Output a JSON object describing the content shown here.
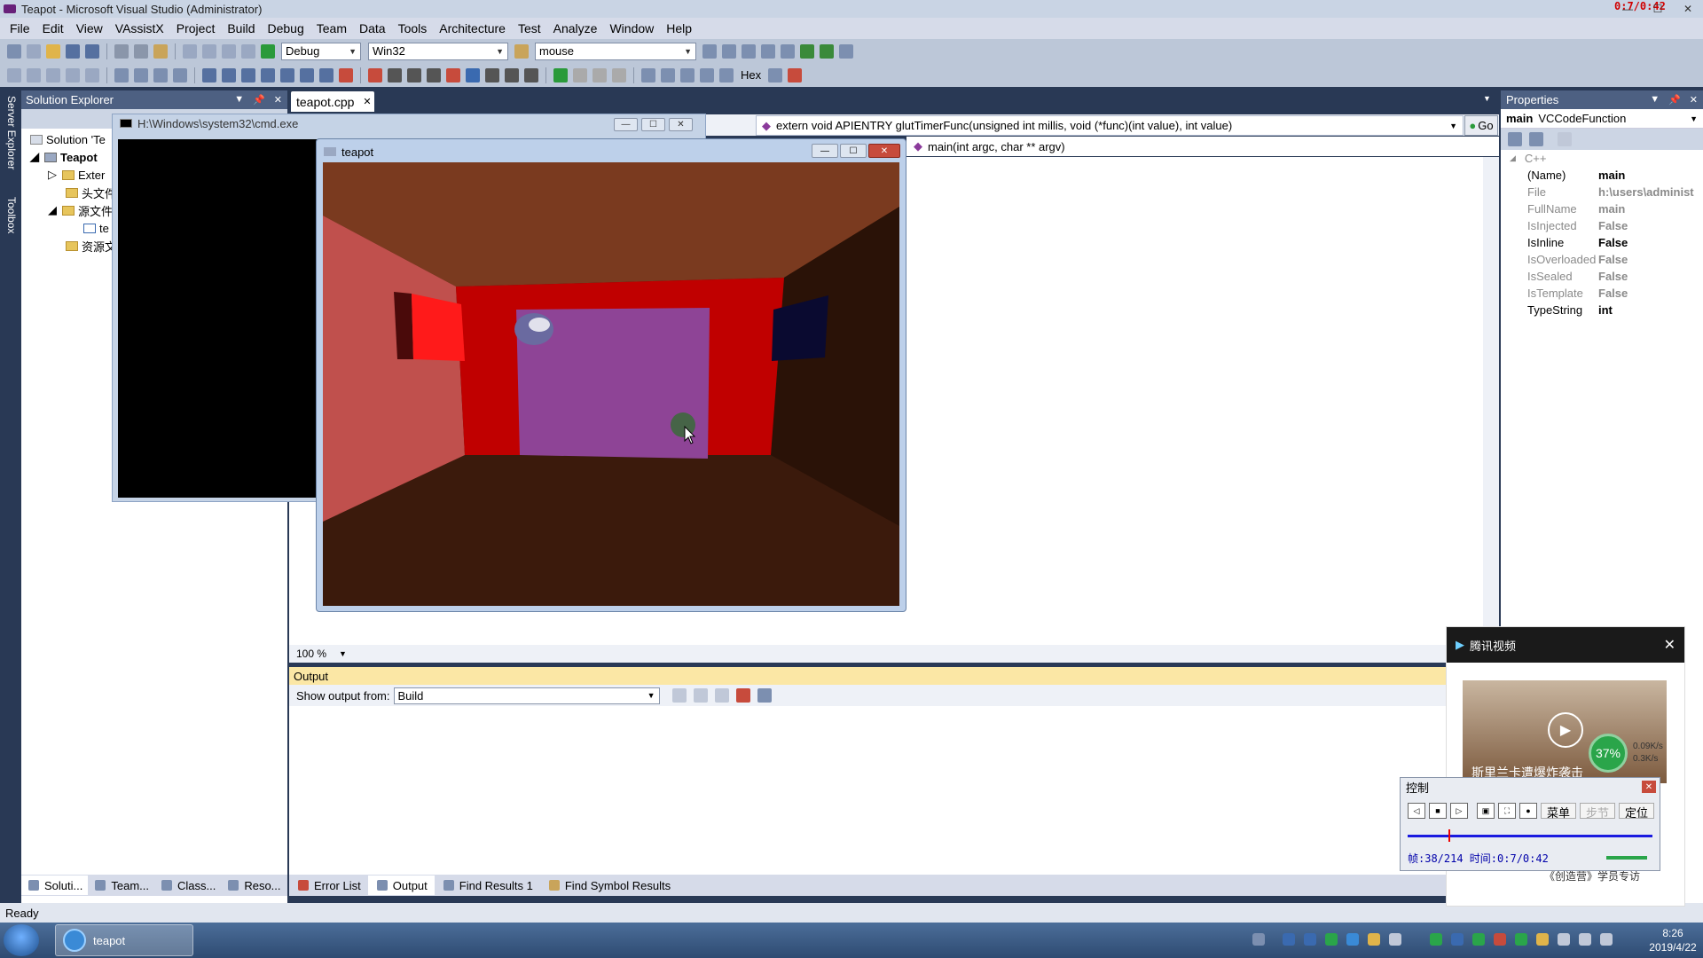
{
  "window": {
    "title": "Teapot - Microsoft Visual Studio (Administrator)",
    "recorder_time": "0:7/0:42"
  },
  "menu": [
    "File",
    "Edit",
    "View",
    "VAssistX",
    "Project",
    "Build",
    "Debug",
    "Team",
    "Data",
    "Tools",
    "Architecture",
    "Test",
    "Analyze",
    "Window",
    "Help"
  ],
  "toolbar": {
    "config": "Debug",
    "platform": "Win32",
    "find": "mouse",
    "hex_label": "Hex"
  },
  "left_strip": {
    "server_explorer": "Server Explorer",
    "toolbox": "Toolbox"
  },
  "solution_explorer": {
    "title": "Solution Explorer",
    "items": [
      "Solution 'Te",
      "Teapot",
      "Exter",
      "头文件",
      "源文件",
      "te",
      "资源文"
    ]
  },
  "left_tabs": [
    "Soluti...",
    "Team...",
    "Class...",
    "Reso..."
  ],
  "editor": {
    "tab": "teapot.cpp",
    "nav_func": "extern void APIENTRY glutTimerFunc(unsigned int millis, void (*func)(int value), int value)",
    "go_label": "Go",
    "nav_member": "main(int argc, char ** argv)",
    "zoom": "100 %"
  },
  "cmd_window": {
    "title": "H:\\Windows\\system32\\cmd.exe"
  },
  "teapot_window": {
    "title": "teapot"
  },
  "properties": {
    "title": "Properties",
    "object": "main",
    "object_type": "VCCodeFunction",
    "category": "C++",
    "rows": [
      {
        "name": "(Name)",
        "value": "main",
        "gray": false
      },
      {
        "name": "File",
        "value": "h:\\users\\administ",
        "gray": true
      },
      {
        "name": "FullName",
        "value": "main",
        "gray": true
      },
      {
        "name": "IsInjected",
        "value": "False",
        "gray": true
      },
      {
        "name": "IsInline",
        "value": "False",
        "gray": false
      },
      {
        "name": "IsOverloaded",
        "value": "False",
        "gray": true
      },
      {
        "name": "IsSealed",
        "value": "False",
        "gray": true
      },
      {
        "name": "IsTemplate",
        "value": "False",
        "gray": true
      },
      {
        "name": "TypeString",
        "value": "int",
        "gray": false
      }
    ]
  },
  "output": {
    "title": "Output",
    "show_from_label": "Show output from:",
    "source": "Build"
  },
  "bottom_tabs": [
    "Error List",
    "Output",
    "Find Results 1",
    "Find Symbol Results"
  ],
  "status": "Ready",
  "taskbar": {
    "app": "teapot",
    "time": "8:26",
    "date": "2019/4/22"
  },
  "tencent": {
    "title": "腾讯视频",
    "caption": "斯里兰卡遭爆炸袭击",
    "percent": "37%",
    "net_up": "0.09K/s",
    "net_down": "0.3K/s",
    "footer": "《创造营》学员专访"
  },
  "control": {
    "title": "控制",
    "btn_menu": "菜单",
    "btn_step": "步节",
    "btn_locate": "定位",
    "info": "帧:38/214 时间:0:7/0:42",
    "progress": 0.167
  }
}
